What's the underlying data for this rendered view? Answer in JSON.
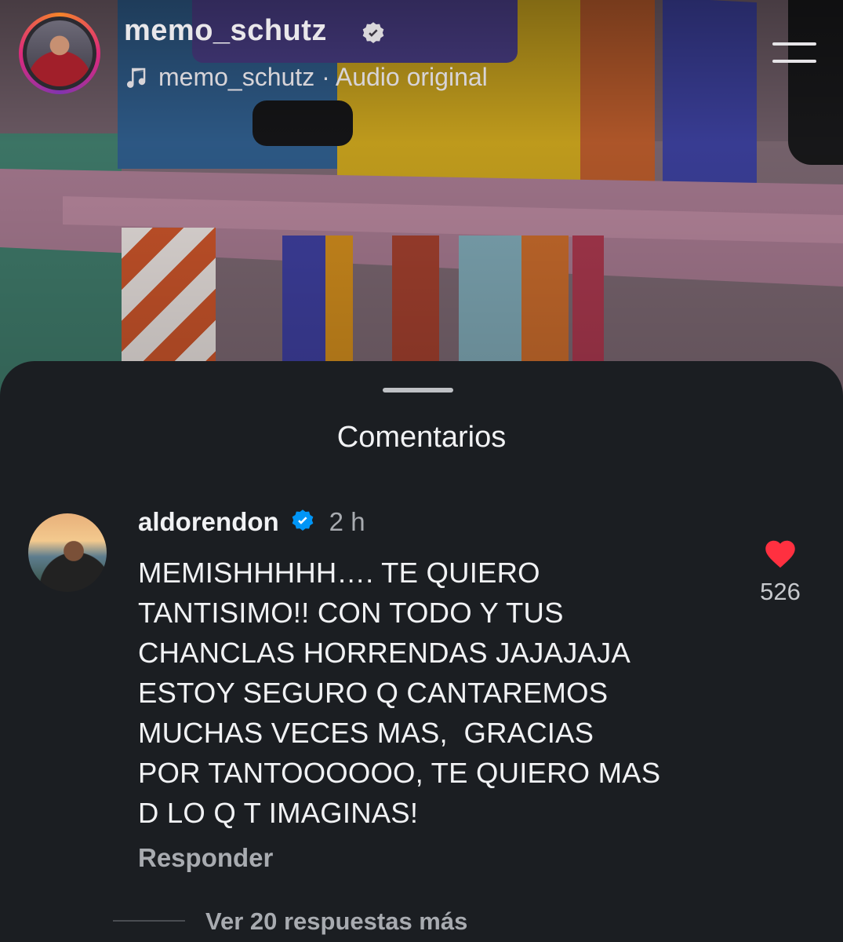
{
  "post": {
    "username": "memo_schutz",
    "audio_label": "memo_schutz · Audio original"
  },
  "comments_sheet": {
    "title": "Comentarios",
    "comments": [
      {
        "username": "aldorendon",
        "time": "2 h",
        "text": "MEMISHHHHH…. TE QUIERO\nTANTISIMO!! CON TODO Y TUS\nCHANCLAS HORRENDAS JAJAJAJA\nESTOY SEGURO Q CANTAREMOS\nMUCHAS VECES MAS,  GRACIAS\nPOR TANTOOOOOO, TE QUIERO MAS\nD LO Q T IMAGINAS!",
        "likes": "526",
        "reply_label": "Responder",
        "view_replies_label": "Ver 20 respuestas más"
      }
    ]
  },
  "colors": {
    "sheet_background": "#1b1e22",
    "verified_blue": "#0095f6",
    "like_red": "#ff3040"
  },
  "icons": {
    "verified": "verified-badge-icon",
    "music": "music-note-icon",
    "menu": "menu-icon",
    "like": "heart-icon"
  }
}
